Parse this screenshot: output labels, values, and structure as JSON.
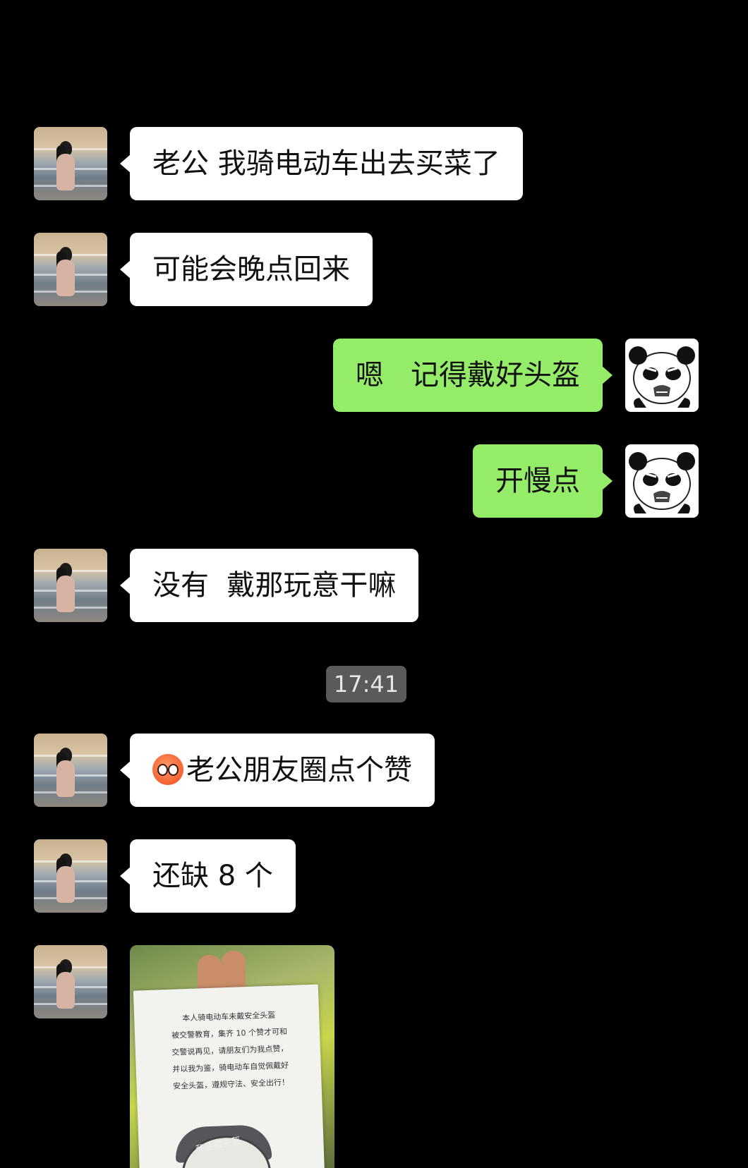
{
  "messages": [
    {
      "side": "left",
      "text": "老公 我骑电动车出去买菜了"
    },
    {
      "side": "left",
      "text": "可能会晚点回来"
    },
    {
      "side": "right",
      "text": "嗯   记得戴好头盔"
    },
    {
      "side": "right",
      "text": "开慢点"
    },
    {
      "side": "left",
      "text": "没有  戴那玩意干嘛"
    },
    {
      "side": "left",
      "text": "老公朋友圈点个赞",
      "emoji": "flushed-face-emoji"
    },
    {
      "side": "left",
      "text": "还缺 8 个"
    }
  ],
  "timestamp": "17:41",
  "photo": {
    "paper_text": "本人骑电动车未戴安全头盔\n被交警教育，集齐 10 个赞才可和\n交警说再见，请朋友们为我点赞，\n并以我为鉴，骑电动车自觉佩戴好\n安全头盔，遵规守法、安全出行！",
    "cap_text": "我要戴头盔"
  },
  "icons": {
    "contact_avatar": "woman-photo-avatar",
    "my_avatar": "panda-meme-avatar"
  },
  "colors": {
    "background": "#000000",
    "incoming_bubble": "#ffffff",
    "outgoing_bubble": "#95ec69",
    "timestamp_bg": "#5a5a5a"
  }
}
